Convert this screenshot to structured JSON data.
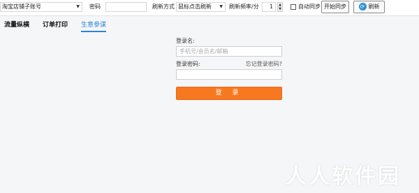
{
  "toolbar": {
    "shop_account_placeholder": "淘宝店铺子账号",
    "password_label": "密码",
    "refresh_mode_label": "刷新方式",
    "refresh_mode_value": "鼠标点击刷新",
    "refresh_rate_label": "刷新频率/分",
    "refresh_rate_value": "1",
    "auto_sync_label": "自动同步",
    "start_sync_label": "开始同步",
    "refresh_label": "刷新",
    "refresh_icon": "refresh-icon"
  },
  "tabs": [
    {
      "label": "流量纵横",
      "active": false
    },
    {
      "label": "订单打印",
      "active": false
    },
    {
      "label": "生意参谋",
      "active": true
    }
  ],
  "login": {
    "username_label": "登录名:",
    "username_placeholder": "手机号/会员名/邮箱",
    "password_label": "登录密码:",
    "forgot_label": "忘记登录密码?",
    "submit_label": "登 录"
  },
  "watermark": "人人软件园",
  "colors": {
    "accent": "#2a85d8",
    "login_button": "#f7781e",
    "background": "#f5f6f7"
  }
}
